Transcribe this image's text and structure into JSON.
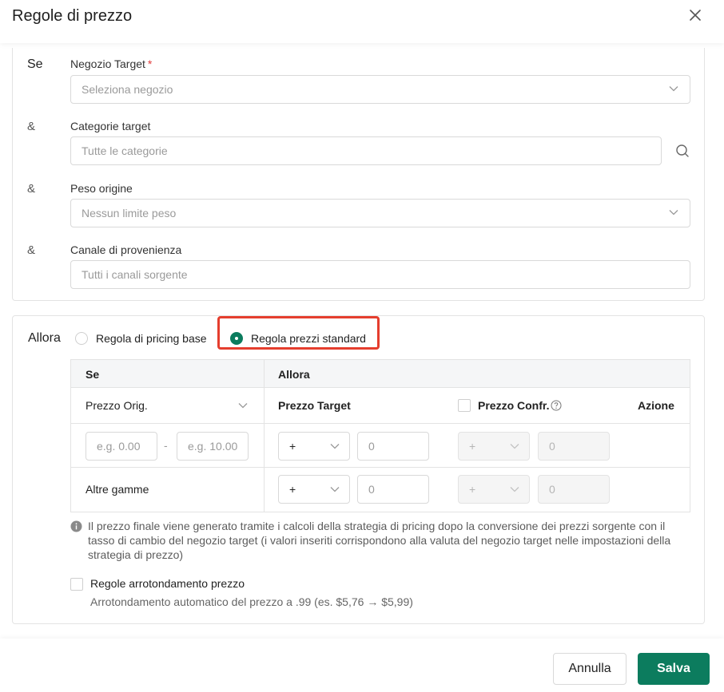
{
  "dialog": {
    "title": "Regole di prezzo"
  },
  "conditions": {
    "if_label": "Se",
    "and_label": "&",
    "store": {
      "label": "Negozio Target",
      "required_mark": "*",
      "placeholder": "Seleziona negozio"
    },
    "categories": {
      "label": "Categorie target",
      "placeholder": "Tutte le categorie"
    },
    "weight": {
      "label": "Peso origine",
      "placeholder": "Nessun limite peso"
    },
    "channel": {
      "label": "Canale di provenienza",
      "placeholder": "Tutti i canali sorgente"
    }
  },
  "then": {
    "label": "Allora",
    "options": [
      {
        "label": "Regola di pricing base",
        "selected": false
      },
      {
        "label": "Regola prezzi standard",
        "selected": true
      }
    ],
    "table": {
      "header_if": "Se",
      "header_then": "Allora",
      "col_source": "Prezzo Orig.",
      "col_target": "Prezzo Target",
      "col_compare": "Prezzo Confr.",
      "col_action": "Azione",
      "range_min_placeholder": "e.g. 0.00",
      "range_sep": "-",
      "range_max_placeholder": "e.g. 10.00",
      "other_ranges": "Altre gamme",
      "operator": "+",
      "value": "0"
    },
    "note": "Il prezzo finale viene generato tramite i calcoli della strategia di pricing dopo la conversione dei prezzi sorgente con il tasso di cambio del negozio target (i valori inseriti corrispondono alla valuta del negozio target nelle impostazioni della strategia di prezzo)",
    "rounding": {
      "label": "Regole arrotondamento prezzo",
      "description": "Arrotondamento automatico del prezzo a .99 (es. $5,76 → $5,99)"
    }
  },
  "footer": {
    "cancel": "Annulla",
    "save": "Salva"
  },
  "colors": {
    "primary": "#0c7c5e",
    "highlight": "#e53e2e",
    "required": "#e23b3b"
  }
}
